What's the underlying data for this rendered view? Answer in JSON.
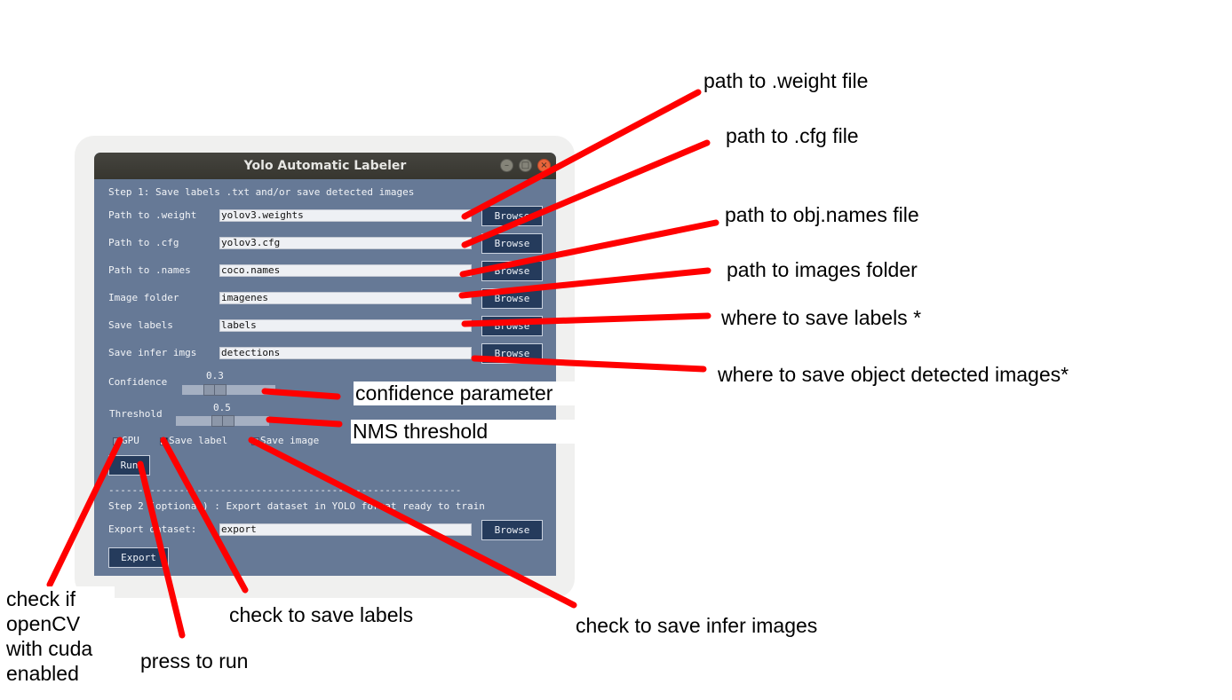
{
  "window": {
    "title": "Yolo Automatic Labeler",
    "controls": [
      "minimize-icon",
      "maximize-icon",
      "close-icon"
    ]
  },
  "step1": {
    "heading": "Step 1: Save labels .txt and/or save detected images",
    "rows": [
      {
        "label": "Path to .weight",
        "value": "yolov3.weights",
        "button": "Browse"
      },
      {
        "label": "Path to .cfg",
        "value": "yolov3.cfg",
        "button": "Browse"
      },
      {
        "label": "Path to .names",
        "value": "coco.names",
        "button": "Browse"
      },
      {
        "label": "Image folder",
        "value": "imagenes",
        "button": "Browse"
      },
      {
        "label": "Save labels",
        "value": "labels",
        "button": "Browse"
      },
      {
        "label": "Save infer imgs",
        "value": "detections",
        "button": "Browse"
      }
    ],
    "confidence": {
      "label": "Confidence",
      "value": "0.3",
      "fraction": 0.3
    },
    "threshold": {
      "label": "Threshold",
      "value": "0.5",
      "fraction": 0.5
    },
    "checkboxes": [
      {
        "label": "GPU",
        "checked": false
      },
      {
        "label": "Save label",
        "checked": true
      },
      {
        "label": "Save image",
        "checked": false
      }
    ],
    "run_button": "Run"
  },
  "separator": "------------------------------------------------------------",
  "step2": {
    "heading": "Step 2 (optional) : Export dataset in YOLO format ready to train",
    "export_label": "Export dataset:",
    "export_value": "export",
    "browse_button": "Browse",
    "export_button": "Export"
  },
  "annotations": {
    "weight": "path to .weight file",
    "cfg": "path to .cfg file",
    "names": "path to obj.names file",
    "images": "path to images folder",
    "save_labels": "where to save labels *",
    "save_imgs": "where to save object detected images*",
    "confidence": "confidence parameter",
    "nms": "NMS threshold",
    "gpu": "check if\nopenCV\nwith cuda\nenabled",
    "save_label_check": "check to save labels",
    "run": "press to run",
    "save_image_check": "check to save infer images"
  },
  "colors": {
    "window_bg": "#667996",
    "button_bg": "#253b5c",
    "annotation_line": "#ff0000"
  }
}
